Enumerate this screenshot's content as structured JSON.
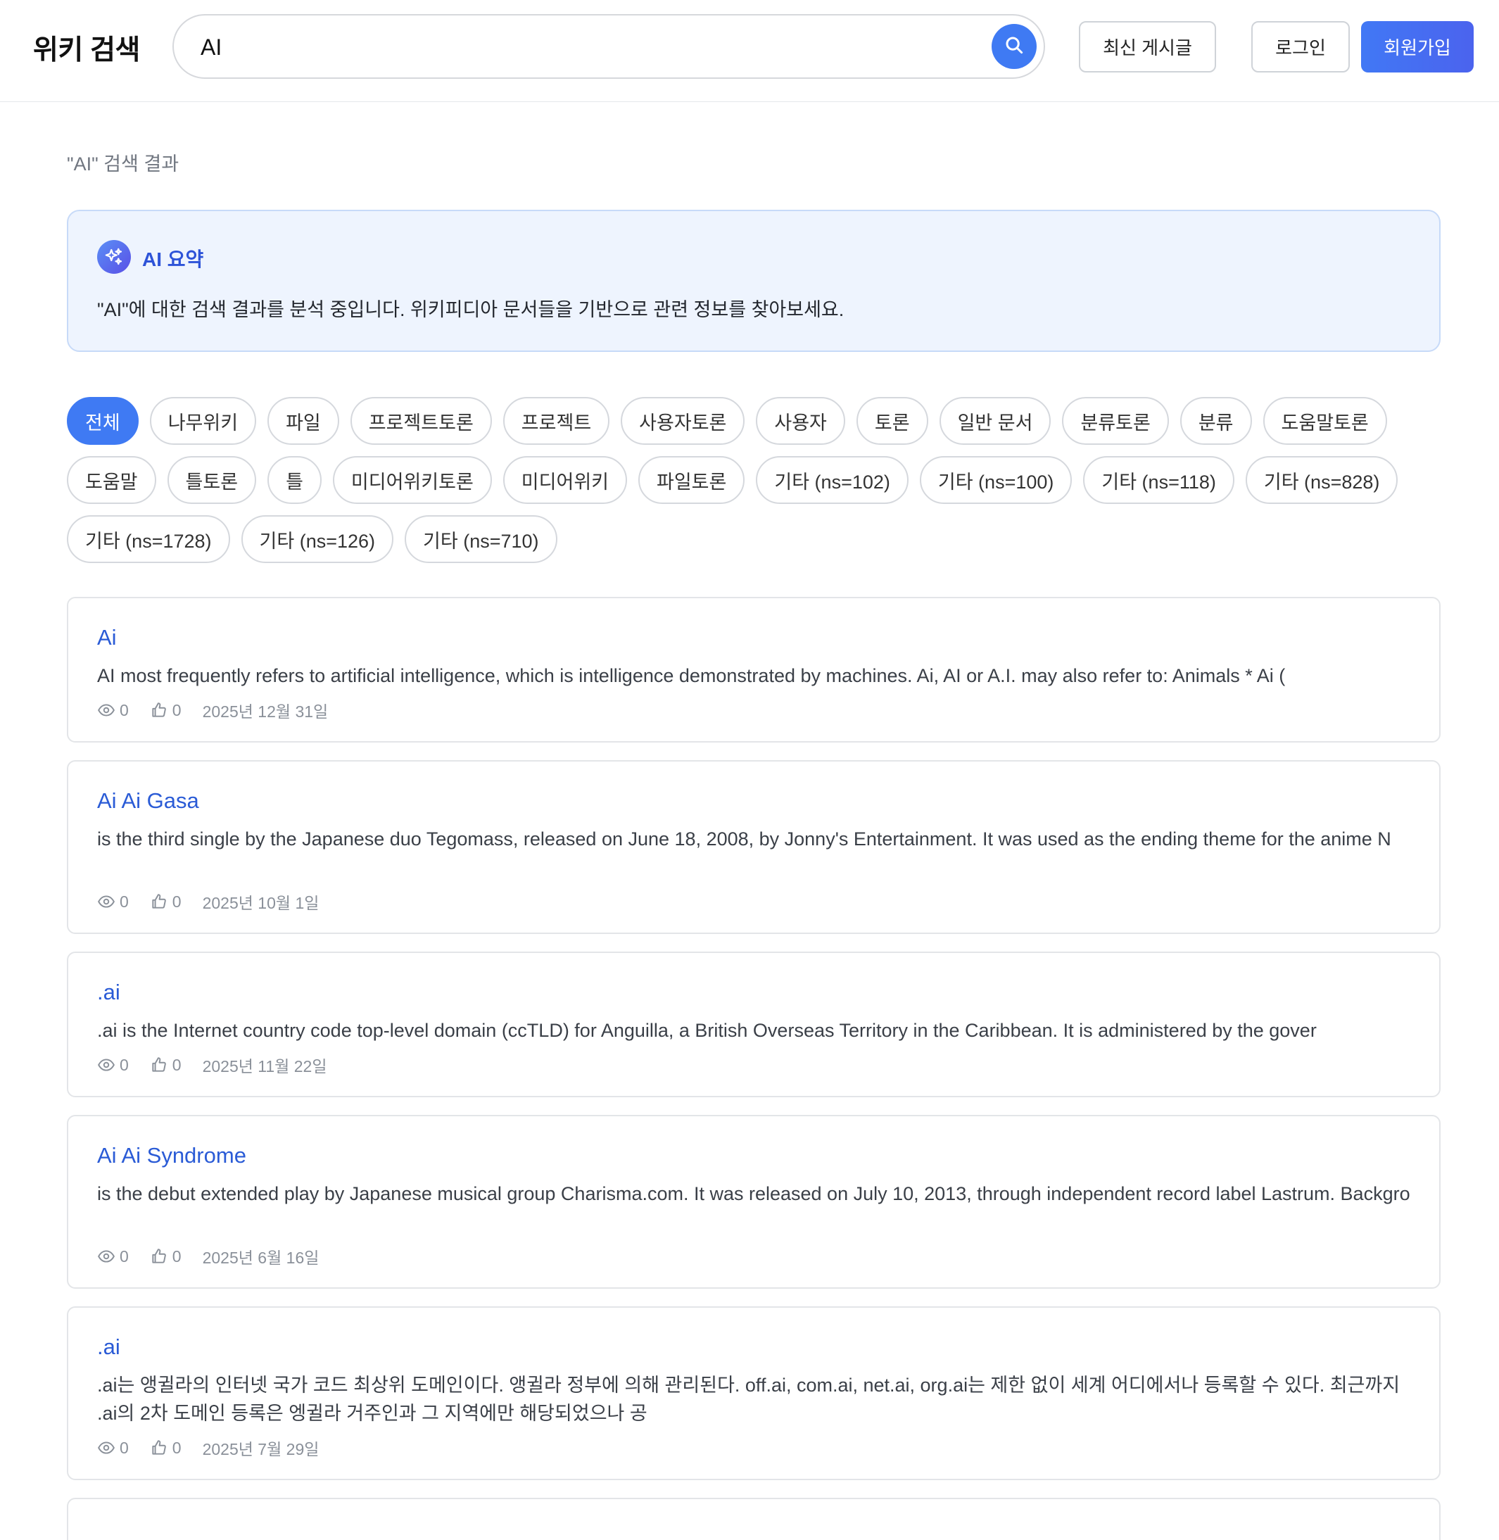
{
  "header": {
    "logo": "위키 검색",
    "search_value": "AI",
    "recent_label": "최신 게시글",
    "login_label": "로그인",
    "signup_label": "회원가입"
  },
  "result_label": "\"AI\" 검색 결과",
  "ai_summary": {
    "title": "AI 요약",
    "text": "\"AI\"에 대한 검색 결과를 분석 중입니다. 위키피디아 문서들을 기반으로 관련 정보를 찾아보세요."
  },
  "filters": {
    "row1": [
      "전체",
      "나무위키",
      "파일",
      "프로젝트토론",
      "프로젝트",
      "사용자토론",
      "사용자",
      "토론",
      "일반 문서",
      "분류토론",
      "분류",
      "도움말토론"
    ],
    "row2": [
      "도움말",
      "틀토론",
      "틀",
      "미디어위키토론",
      "미디어위키",
      "파일토론",
      "기타 (ns=102)",
      "기타 (ns=100)",
      "기타 (ns=118)",
      "기타 (ns=828)"
    ],
    "row3": [
      "기타 (ns=1728)",
      "기타 (ns=126)",
      "기타 (ns=710)"
    ]
  },
  "results": [
    {
      "title": "Ai",
      "desc": "AI most frequently refers to artificial intelligence, which is intelligence demonstrated by machines. Ai, AI or A.I. may also refer to: Animals * Ai (",
      "views": "0",
      "likes": "0",
      "date": "2025년 12월 31일"
    },
    {
      "title": "Ai Ai Gasa",
      "desc": "is the third single by the Japanese duo Tegomass, released on June 18, 2008, by Jonny's Entertainment. It was used as the ending theme for the anime N",
      "views": "0",
      "likes": "0",
      "date": "2025년 10월 1일"
    },
    {
      "title": ".ai",
      "desc": ".ai is the Internet country code top-level domain (ccTLD) for Anguilla, a British Overseas Territory in the Caribbean. It is administered by the gover",
      "views": "0",
      "likes": "0",
      "date": "2025년 11월 22일"
    },
    {
      "title": "Ai Ai Syndrome",
      "desc": "is the debut extended play by Japanese musical group Charisma.com. It was released on July 10, 2013, through independent record label Lastrum. Backgro",
      "views": "0",
      "likes": "0",
      "date": "2025년 6월 16일"
    },
    {
      "title": ".ai",
      "desc": ".ai는 앵귈라의 인터넷 국가 코드 최상위 도메인이다. 앵귈라 정부에 의해 관리된다. off.ai, com.ai, net.ai, org.ai는 제한 없이 세계 어디에서나 등록할 수 있다. 최근까지 .ai의 2차 도메인 등록은 엥귈라 거주인과 그 지역에만 해당되었으나 공",
      "views": "0",
      "likes": "0",
      "date": "2025년 7월 29일"
    }
  ]
}
